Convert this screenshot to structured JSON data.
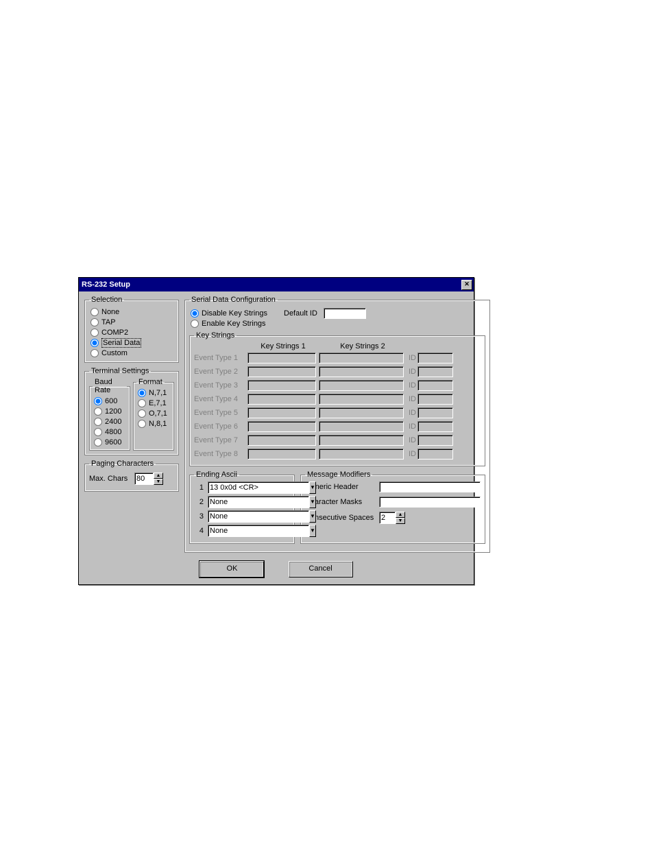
{
  "title": "RS-232 Setup",
  "selection": {
    "legend": "Selection",
    "options": [
      "None",
      "TAP",
      "COMP2",
      "Serial Data",
      "Custom"
    ],
    "selected": 3
  },
  "terminal": {
    "legend": "Terminal Settings",
    "baud": {
      "legend": "Baud Rate",
      "options": [
        "600",
        "1200",
        "2400",
        "4800",
        "9600"
      ],
      "selected": 0
    },
    "format": {
      "legend": "Format",
      "options": [
        "N,7,1",
        "E,7,1",
        "O,7,1",
        "N,8,1"
      ],
      "selected": 0
    }
  },
  "paging": {
    "legend": "Paging Characters",
    "max_chars_label": "Max. Chars",
    "max_chars_value": "80"
  },
  "sdc": {
    "legend": "Serial Data Configuration",
    "disable_label": "Disable Key Strings",
    "enable_label": "Enable Key Strings",
    "default_id_label": "Default ID",
    "default_id_value": "",
    "keystrings": {
      "legend": "Key Strings",
      "col1": "Key Strings 1",
      "col2": "Key Strings 2",
      "id_label": "ID",
      "rows": [
        "Event Type 1",
        "Event Type 2",
        "Event Type 3",
        "Event Type 4",
        "Event Type 5",
        "Event Type 6",
        "Event Type 7",
        "Event Type 8"
      ]
    },
    "ending_ascii": {
      "legend": "Ending Ascii",
      "items": [
        "13 0x0d <CR>",
        "None",
        "None",
        "None"
      ]
    },
    "modifiers": {
      "legend": "Message Modifiers",
      "generic_header_label": "Generic Header",
      "generic_header_value": "",
      "char_masks_label": "Character Masks",
      "char_masks_value": "",
      "consec_spaces_label": "Consecutive Spaces",
      "consec_spaces_value": "2"
    }
  },
  "buttons": {
    "ok": "OK",
    "cancel": "Cancel"
  }
}
